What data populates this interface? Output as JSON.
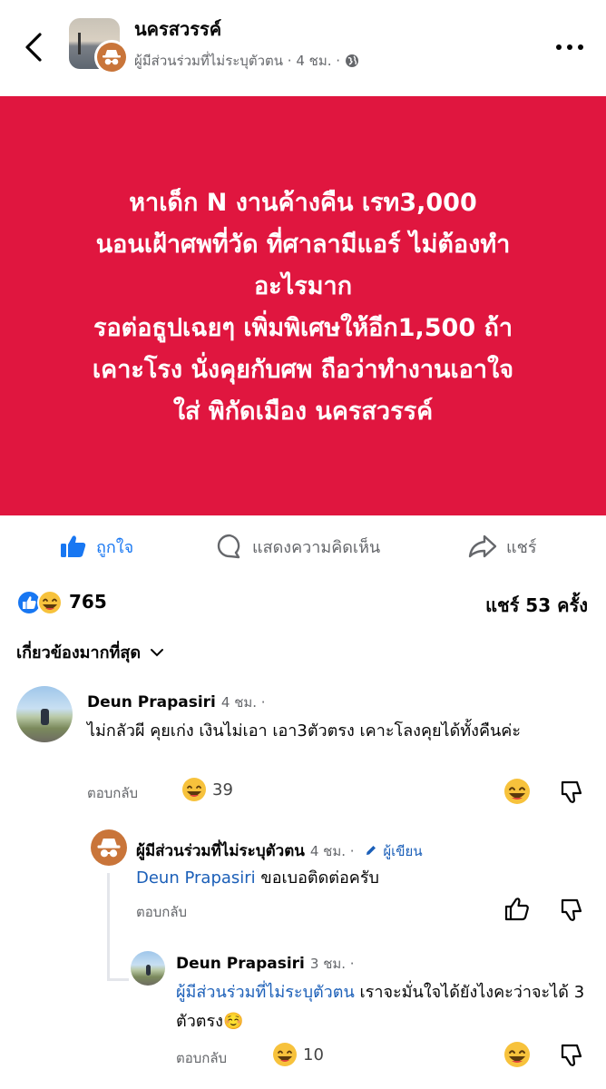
{
  "header": {
    "group_name": "นครสวรรค์",
    "author": "ผู้มีส่วนร่วมที่ไม่ระบุตัวตน",
    "time": "4 ชม.",
    "separator": "·"
  },
  "post": {
    "background_color": "#e0163f",
    "text": "หาเด็ก N งานค้างคืน เรท3,000\nนอนเฝ้าศพที่วัด ที่ศาลามีแอร์ ไม่ต้องทำ\nอะไรมาก\nรอต่อธูปเฉยๆ  เพิ่มพิเศษให้อีก1,500 ถ้า\nเคาะโรง นั่งคุยกับศพ ถือว่าทำงานเอาใจ\nใส่ พิกัดเมือง นครสวรรค์"
  },
  "actions": {
    "like": "ถูกใจ",
    "comment": "แสดงความคิดเห็น",
    "share": "แชร์"
  },
  "stats": {
    "reactions": "765",
    "shares": "แชร์ 53 ครั้ง"
  },
  "sort": {
    "label": "เกี่ยวข้องมากที่สุด"
  },
  "comments": [
    {
      "name": "Deun Prapasiri",
      "time": "4 ชม. ·",
      "text": "ไม่กลัวผี คุยเก่ง เงินไม่เอา เอา3ตัวตรง เคาะโลงคุยได้ทั้งคืนค่ะ",
      "reply": "ตอบกลับ",
      "reaction_count": "39"
    },
    {
      "name": "ผู้มีส่วนร่วมที่ไม่ระบุตัวตน",
      "time": "4 ชม. ·",
      "author_tag": "ผู้เขียน",
      "mention": "Deun Prapasiri",
      "text": " ขอเบอติดต่อครับ",
      "reply": "ตอบกลับ"
    },
    {
      "name": "Deun Prapasiri",
      "time": "3 ชม. ·",
      "mention": "ผู้มีส่วนร่วมที่ไม่ระบุตัวตน",
      "text": " เราจะมั่นใจได้ยังไงคะว่าจะได้ 3 ตัวตรง☺️",
      "reply": "ตอบกลับ",
      "reaction_count": "10"
    }
  ]
}
